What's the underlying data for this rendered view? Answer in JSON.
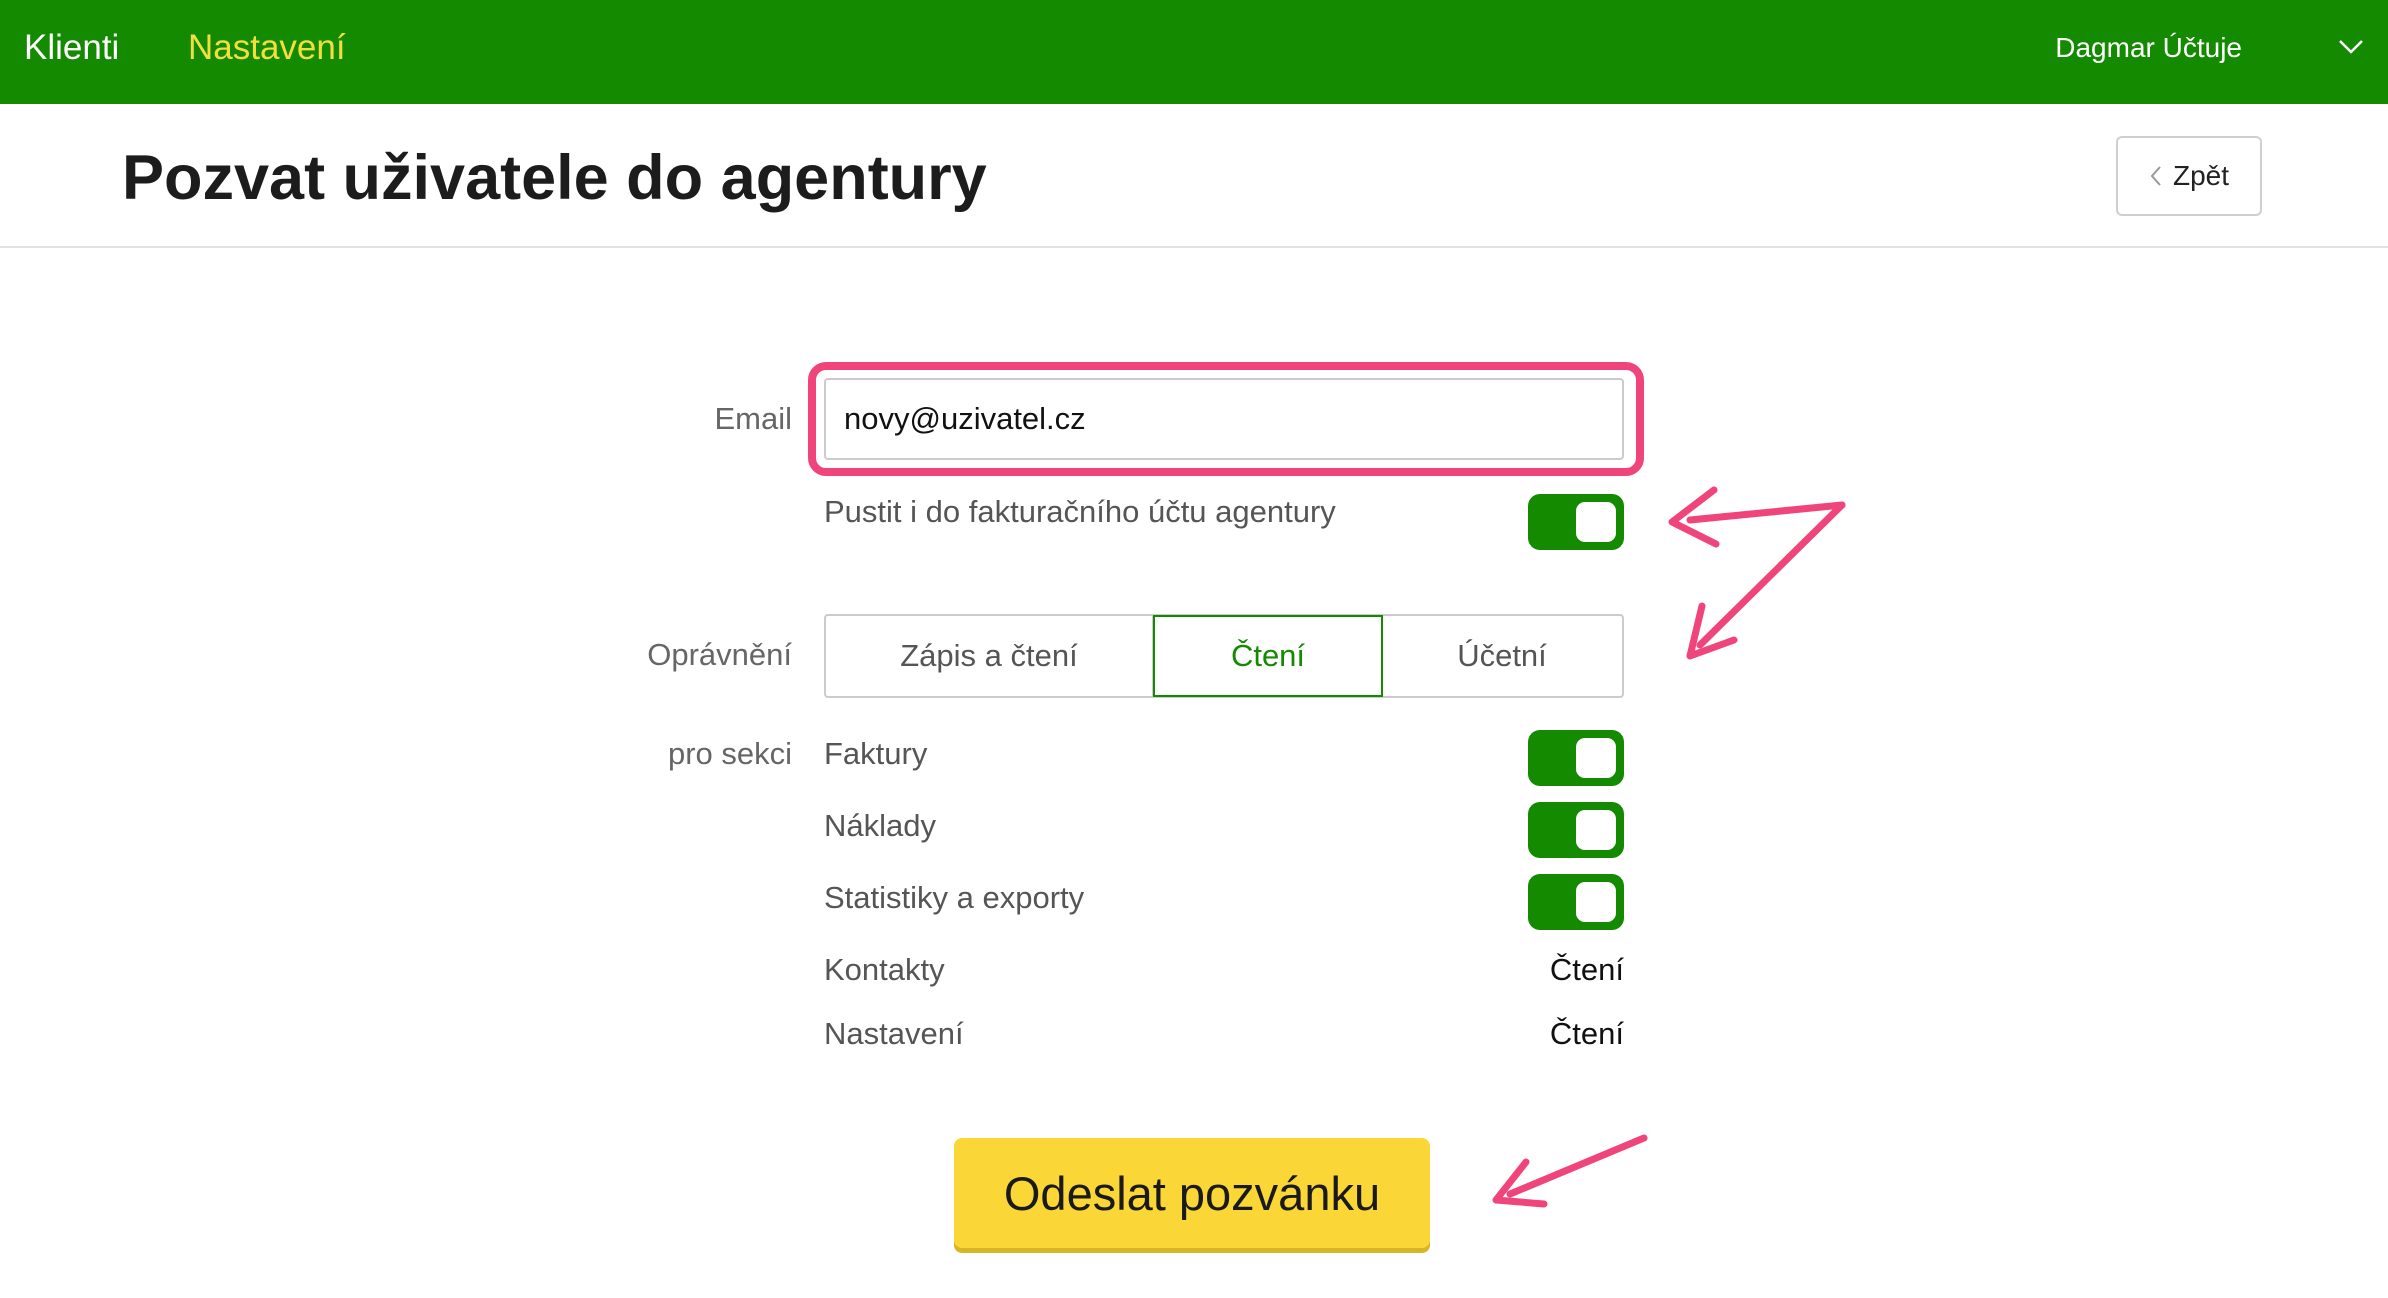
{
  "topbar": {
    "nav": [
      "Klienti",
      "Nastavení"
    ],
    "user": "Dagmar Účtuje",
    "menu_icon": "chevron-down-icon",
    "color": "#138a00",
    "active_color": "#f3df3c"
  },
  "header": {
    "title": "Pozvat uživatele do agentury",
    "back_label": "Zpět",
    "back_icon": "chevron-left-icon"
  },
  "form": {
    "email_label": "Email",
    "email_value": "novy@uzivatel.cz",
    "billing_label": "Pustit i do fakturačního účtu agentury",
    "billing_on": true,
    "permissions_label": "Oprávnění",
    "permission_options": [
      "Zápis a čtení",
      "Čtení",
      "Účetní"
    ],
    "permission_selected": "Čtení",
    "sections_label": "pro sekci",
    "sections": [
      {
        "name": "Faktury",
        "enabled": true
      },
      {
        "name": "Náklady",
        "enabled": true
      },
      {
        "name": "Statistiky a exporty",
        "enabled": true
      },
      {
        "name": "Kontakty",
        "value": "Čtení"
      },
      {
        "name": "Nastavení",
        "value": "Čtení"
      }
    ],
    "submit_label": "Odeslat pozvánku",
    "submit_color": "#fad637"
  },
  "annotation_color": "#f0457a"
}
